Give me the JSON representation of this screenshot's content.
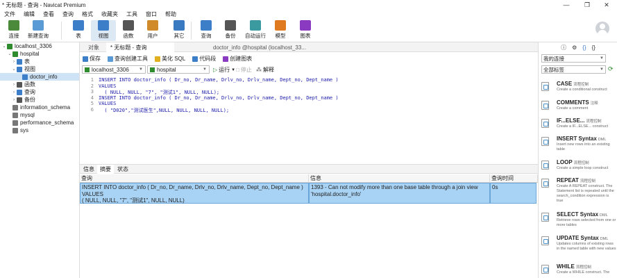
{
  "window": {
    "title": "* 无标题 - 查询 - Navicat Premium",
    "controls": [
      "—",
      "❐",
      "✕"
    ]
  },
  "menu": [
    "文件",
    "编辑",
    "查看",
    "查询",
    "格式",
    "收藏夹",
    "工具",
    "窗口",
    "帮助"
  ],
  "toolbar": [
    {
      "label": "连接",
      "icon": "connect-icon",
      "color": "#4a8a3a"
    },
    {
      "label": "新建查询",
      "icon": "new-query-icon",
      "color": "#5b9bd5"
    },
    {
      "label": "表",
      "icon": "table-icon",
      "color": "#3d7ec9"
    },
    {
      "label": "视图",
      "icon": "view-icon",
      "color": "#3d7ec9"
    },
    {
      "label": "函数",
      "icon": "function-icon",
      "color": "#555555"
    },
    {
      "label": "用户",
      "icon": "user-icon",
      "color": "#d08a2a"
    },
    {
      "label": "其它",
      "icon": "other-icon",
      "color": "#3a7ac0"
    },
    {
      "label": "查询",
      "icon": "query-icon",
      "color": "#3d7ec9"
    },
    {
      "label": "备份",
      "icon": "backup-icon",
      "color": "#555555"
    },
    {
      "label": "自动运行",
      "icon": "auto-run-icon",
      "color": "#3a9aa0"
    },
    {
      "label": "模型",
      "icon": "model-icon",
      "color": "#e07a20"
    },
    {
      "label": "图表",
      "icon": "chart-icon",
      "color": "#8a3ac0"
    }
  ],
  "sidebar": {
    "items": [
      {
        "label": "localhost_3306",
        "arrow": "⌄",
        "icon_color": "#2e8b2e"
      },
      {
        "label": "hospital",
        "arrow": "⌄",
        "icon_color": "#2e8b2e"
      },
      {
        "label": "表",
        "arrow": "›",
        "icon_color": "#3d7ec9"
      },
      {
        "label": "视图",
        "arrow": "⌄",
        "icon_color": "#3d7ec9"
      },
      {
        "label": "doctor_info",
        "arrow": "",
        "icon_color": "#3d7ec9"
      },
      {
        "label": "函数",
        "arrow": "›",
        "icon_color": "#555555"
      },
      {
        "label": "查询",
        "arrow": "›",
        "icon_color": "#3d7ec9"
      },
      {
        "label": "备份",
        "arrow": "›",
        "icon_color": "#555555"
      },
      {
        "label": "information_schema",
        "arrow": "",
        "icon_color": "#777777"
      },
      {
        "label": "mysql",
        "arrow": "",
        "icon_color": "#777777"
      },
      {
        "label": "performance_schema",
        "arrow": "",
        "icon_color": "#777777"
      },
      {
        "label": "sys",
        "arrow": "",
        "icon_color": "#777777"
      }
    ]
  },
  "tabs": [
    {
      "label": "对象"
    },
    {
      "label": "* 无标题 - 查询"
    },
    {
      "label": "doctor_info @hospital (localhost_33..."
    }
  ],
  "query_toolbar": [
    "保存",
    "查询创建工具",
    "美化 SQL",
    "代码段",
    "创建图表"
  ],
  "selectors": {
    "connection": "localhost_3306",
    "database": "hospital",
    "run": "运行",
    "stop": "停止",
    "explain": "解释"
  },
  "editor": {
    "lines": [
      "1",
      "2",
      "3",
      "4",
      "5",
      "6"
    ],
    "code": [
      "INSERT INTO doctor_info ( Dr_no, Dr_name, Drlv_no, Drlv_name, Dept_no, Dept_name )",
      "VALUES",
      "  ( NULL, NULL, \"7\", \"测试1\", NULL, NULL);",
      "INSERT INTO doctor_info ( Dr_no, Dr_name, Drlv_no, Drlv_name, Dept_no, Dept_name )",
      "VALUES",
      "  ( \"D020\",\"测试医生\",NULL, NULL, NULL, NULL);"
    ]
  },
  "result_tabs": [
    "信息",
    "摘要",
    "状态"
  ],
  "result": {
    "headers": [
      "查询",
      "信息",
      "查询时间"
    ],
    "row": {
      "query": [
        "INSERT INTO doctor_info ( Dr_no, Dr_name, Drlv_no, Drlv_name, Dept_no, Dept_name )",
        "VALUES",
        "( NULL, NULL, \"7\", \"测试1\", NULL, NULL)"
      ],
      "info": [
        "1393 - Can not modify more than one base table through a join view",
        "'hospital.doctor_info'"
      ],
      "time": "0s"
    }
  },
  "right_panel": {
    "icons": [
      "ⓘ",
      "⚙",
      "{}",
      "{}"
    ],
    "connection_select": "我的连接",
    "tag_select": "全部标签",
    "snippets": [
      {
        "title": "CASE",
        "tag": "流程控制",
        "desc": "Create a conditional construct"
      },
      {
        "title": "COMMENTS",
        "tag": "注释",
        "desc": "Create a comment"
      },
      {
        "title": "IF...ELSE...",
        "tag": "流程控制",
        "desc": "Create a IF...ELSE... construct"
      },
      {
        "title": "INSERT Syntax",
        "tag": "DML",
        "desc": "Insert new rows into an existing table"
      },
      {
        "title": "LOOP",
        "tag": "流程控制",
        "desc": "Create a simple loop construct"
      },
      {
        "title": "REPEAT",
        "tag": "流程控制",
        "desc": "Create A REPEAT construct. The Statement list is repeated until the search_condition expression is true"
      },
      {
        "title": "SELECT Syntax",
        "tag": "DML",
        "desc": "Retrieve rows selected from one or more tables"
      },
      {
        "title": "UPDATE Syntax",
        "tag": "DML",
        "desc": "Updates columns of existing rows in the named table with new values"
      },
      {
        "title": "WHILE",
        "tag": "流程控制",
        "desc": "Create a WHILE construct. The"
      }
    ]
  }
}
